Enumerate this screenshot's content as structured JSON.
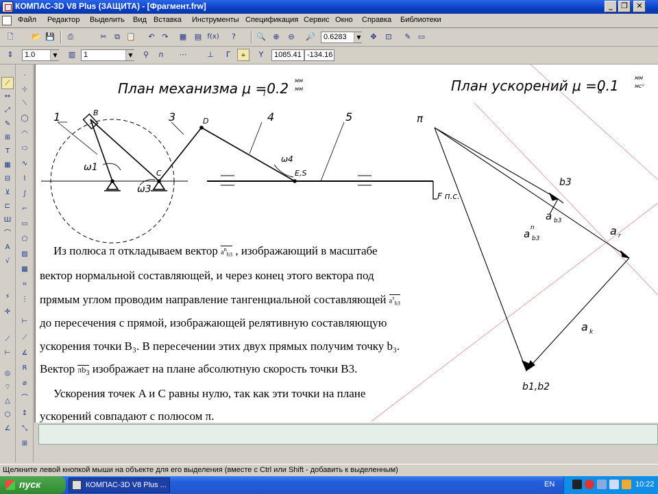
{
  "window": {
    "title": "КОМПАС-3D V8 Plus (ЗАЩИТА) - [Фрагмент.frw]",
    "controls": [
      "_",
      "❐",
      "✕"
    ]
  },
  "menu": {
    "items": [
      "Файл",
      "Редактор",
      "Выделить",
      "Вид",
      "Вставка",
      "Инструменты",
      "Спецификация",
      "Сервис",
      "Окно",
      "Справка",
      "Библиотеки"
    ],
    "doc_controls": [
      "_",
      "❐",
      "✕"
    ]
  },
  "toolbar_standard": {
    "zoom_value": "0.6283"
  },
  "toolbar_current": {
    "step_value": "1.0",
    "layer_value": "1",
    "coord_x": "1085.41",
    "coord_y": "-134.16",
    "coord_y_label": "Y"
  },
  "drawing": {
    "mechanism_title": "План механизма μ =0.2",
    "mechanism_mu_sub": "l",
    "mechanism_unit_num": "мм",
    "mechanism_unit_den": "мм",
    "accel_title": "План ускорений μ =0.1",
    "accel_mu_sub": "a",
    "accel_unit_num": "мм",
    "accel_unit_den": "мс²",
    "link_labels": [
      "1",
      "3",
      "4",
      "5"
    ],
    "point_labels": {
      "B": "B",
      "D": "D",
      "C": "C",
      "E": "E,S",
      "pi": "π",
      "b3": "b3",
      "b1b2": "b1,b2"
    },
    "omega_labels": [
      "ω1",
      "ω3",
      "ω4"
    ],
    "force_label": "F п.с.",
    "vector_labels": {
      "an": "a",
      "an_sup": "n",
      "an_sub": "b3",
      "at": "a",
      "at_sub": "b3",
      "ar": "a",
      "ar_sub": "r",
      "ak": "a",
      "ak_sub": "k"
    }
  },
  "explanation": {
    "p1": "Из полюса π откладываем вектор",
    "p1b": ", изображающий в масштабе",
    "p2": "вектор нормальной составляющей, и через конец этого вектора под",
    "p3": "прямым углом проводим направление тангенциальной составляющей",
    "p4": "до пересечения с прямой, изображающей релятивную составляющую",
    "p5": "ускорения точки B₃. В пересечении этих двух прямых получим точку b₃.",
    "p6a": "Вектор",
    "p6b": "изображает на плане абсолютную скорость точки B3.",
    "p7": "Ускорения точек A и C равны нулю, так как эти точки на плане",
    "p8": "ускорений совпадают с полюсом π.",
    "sym_an": "a",
    "sym_an_sup": "n",
    "sym_an_sub": "b3",
    "sym_at": "a",
    "sym_at_sup": "τ",
    "sym_at_sub": "b3",
    "sym_pib": "πb",
    "sym_pib_sub": "3"
  },
  "status_text": "Щелкните левой кнопкой мыши на объекте для его выделения (вместе с Ctrl или Shift - добавить к выделенным)",
  "taskbar": {
    "start_label": "пуск",
    "task_item": "КОМПАС-3D V8 Plus ...",
    "lang": "EN",
    "clock": "10:22"
  },
  "colors": {
    "title_bar": "#0a3fc4",
    "canvas": "#ffffff",
    "construction_line": "#e09090",
    "taskbar": "#245edb",
    "start_button": "#2f8a2f"
  }
}
